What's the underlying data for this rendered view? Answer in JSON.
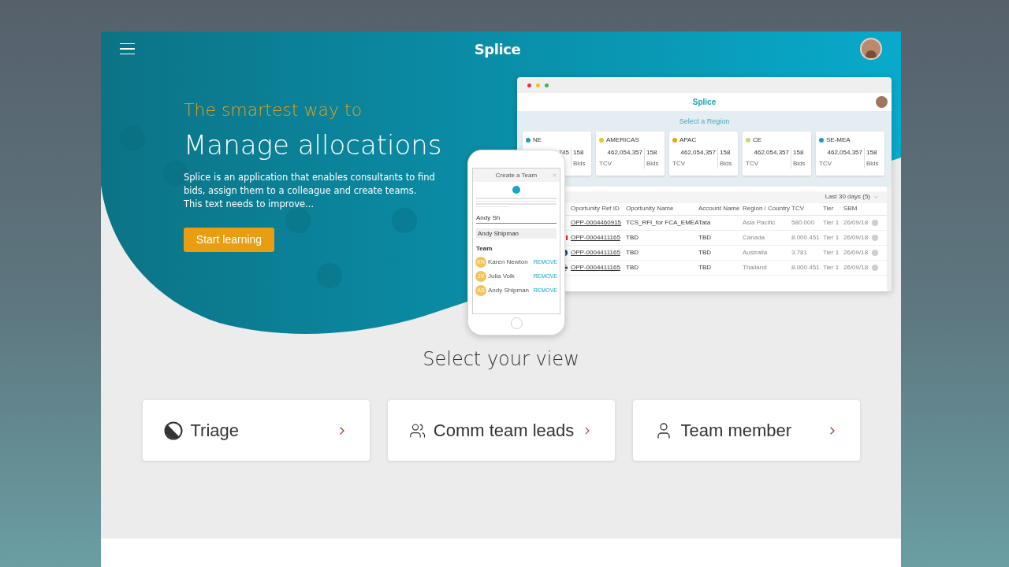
{
  "header": {
    "logo": "Splice"
  },
  "hero": {
    "eyebrow": "The smartest way to",
    "title": "Manage allocations",
    "description_lines": [
      "Splice is an application that enables consultants to find",
      "bids, assign them to a colleague and create teams.",
      "This text needs to improve..."
    ],
    "button": "Start learning"
  },
  "desktop_mockup": {
    "logo": "Splice",
    "heading": "Select a Region",
    "regions": [
      {
        "name": "NE",
        "color": "#1a9fb5",
        "tcv": "745",
        "bids": "158",
        "bids_label": "Bids"
      },
      {
        "name": "AMERICAS",
        "color": "#f2c12e",
        "tcv": "462,054,357",
        "bids": "158",
        "tcv_label": "TCV",
        "bids_label": "Bids"
      },
      {
        "name": "APAC",
        "color": "#f0a020",
        "tcv": "462,054,357",
        "bids": "158",
        "tcv_label": "TCV",
        "bids_label": "Bids"
      },
      {
        "name": "CE",
        "color": "#c5d66a",
        "tcv": "462,054,357",
        "bids": "158",
        "tcv_label": "TCV",
        "bids_label": "Bids"
      },
      {
        "name": "SE-MEA",
        "color": "#1a9fb5",
        "tcv": "462,054,357",
        "bids": "158",
        "tcv_label": "TCV",
        "bids_label": "Bids"
      }
    ],
    "filter": "Last 30 days (5)",
    "columns": [
      "Oportunity Ref ID",
      "Oportunity Name",
      "Account Name",
      "Region / Country",
      "TCV",
      "Tier",
      "SBM"
    ],
    "rows": [
      {
        "kind": "plain",
        "cells": [
          "OPP-0004460915",
          "TCS_RFI_for FCA_EMEA",
          "Tata",
          "Asia Pacific",
          "580.000",
          "Tier 1",
          "26/09/18"
        ]
      },
      {
        "kind": "canada",
        "cells": [
          "OPP-0004411165",
          "TBD",
          "TBD",
          "Canada",
          "8.000.451",
          "Tier 1",
          "26/09/18"
        ]
      },
      {
        "kind": "australia",
        "cells": [
          "OPP-0004411165",
          "TBD",
          "TBD",
          "Australia",
          "3.781",
          "Tier 1",
          "26/09/18"
        ]
      },
      {
        "kind": "thailand",
        "cells": [
          "OPP-0004411165",
          "TBD",
          "TBD",
          "Thailand",
          "8.000.451",
          "Tier 1",
          "26/09/18"
        ]
      }
    ]
  },
  "phone_mockup": {
    "title": "Create a Team",
    "search_value": "Andy Sh",
    "suggestion": "Andy Shipman",
    "team_heading": "Team",
    "members": [
      {
        "initials": "KN",
        "name": "Karen Newton",
        "action": "REMOVE"
      },
      {
        "initials": "JV",
        "name": "Julia Volk",
        "action": "REMOVE"
      },
      {
        "initials": "AS",
        "name": "Andy Shipman",
        "action": "REMOVE"
      }
    ]
  },
  "views": {
    "title": "Select your view",
    "items": [
      {
        "kind": "triage",
        "label": "Triage"
      },
      {
        "kind": "group",
        "label": "Comm team leads"
      },
      {
        "kind": "person",
        "label": "Team member"
      }
    ]
  }
}
